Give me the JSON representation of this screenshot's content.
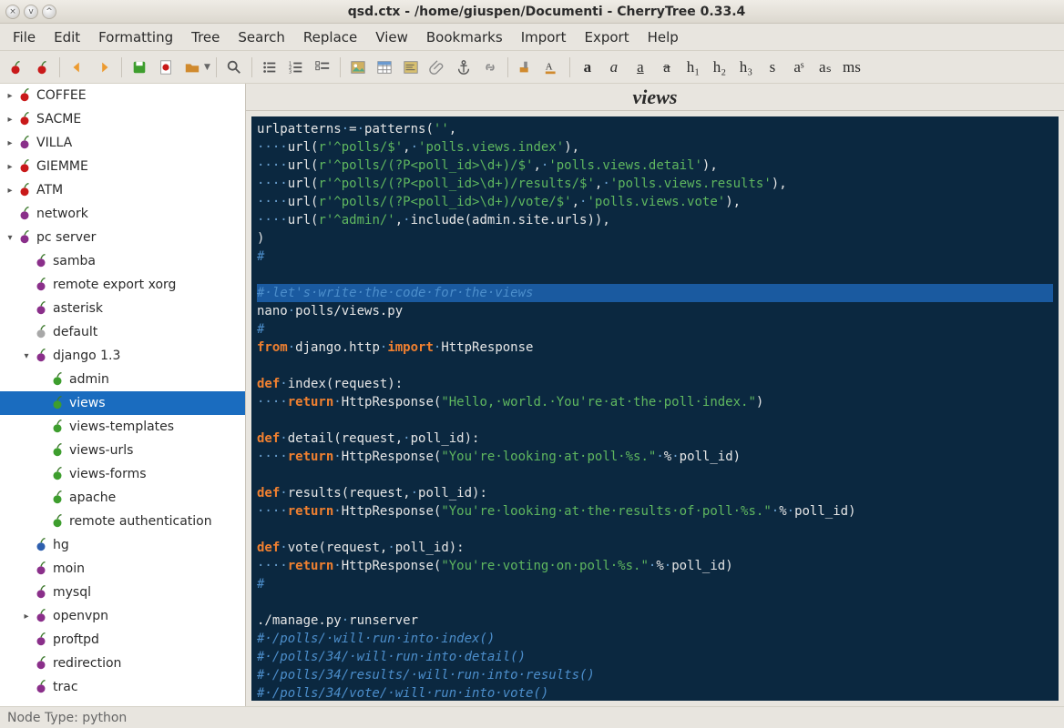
{
  "window": {
    "title": "qsd.ctx - /home/giuspen/Documenti - CherryTree 0.33.4"
  },
  "menu": [
    "File",
    "Edit",
    "Formatting",
    "Tree",
    "Search",
    "Replace",
    "View",
    "Bookmarks",
    "Import",
    "Export",
    "Help"
  ],
  "toolbar": {
    "icons": [
      {
        "name": "cherry-red-icon",
        "kind": "cherry",
        "color": "#c91a1a"
      },
      {
        "name": "cherry-red2-icon",
        "kind": "cherry",
        "color": "#c91a1a"
      },
      {
        "sep": true
      },
      {
        "name": "back-icon",
        "kind": "arrow-left",
        "color": "#ec9a2f"
      },
      {
        "name": "forward-icon",
        "kind": "arrow-right",
        "color": "#ec9a2f"
      },
      {
        "sep": true
      },
      {
        "name": "save-icon",
        "kind": "save",
        "color": "#3e9e2e"
      },
      {
        "name": "pdf-icon",
        "kind": "pdf",
        "color": "#c91a1a"
      },
      {
        "name": "folder-icon",
        "kind": "folder",
        "color": "#d08a2e"
      },
      {
        "name": "folder-drop-icon",
        "kind": "dropdown"
      },
      {
        "sep": true
      },
      {
        "name": "search-icon",
        "kind": "search",
        "color": "#555"
      },
      {
        "sep": true
      },
      {
        "name": "list-ul-icon",
        "kind": "list"
      },
      {
        "name": "list-ol-icon",
        "kind": "list2"
      },
      {
        "name": "list-task-icon",
        "kind": "listchk"
      },
      {
        "sep": true
      },
      {
        "name": "image-icon",
        "kind": "image"
      },
      {
        "name": "table-icon",
        "kind": "table"
      },
      {
        "name": "codebox-icon",
        "kind": "codebox"
      },
      {
        "name": "attach-icon",
        "kind": "attach"
      },
      {
        "name": "anchor-icon",
        "kind": "anchor"
      },
      {
        "name": "link-icon",
        "kind": "link"
      },
      {
        "sep": true
      },
      {
        "name": "paint-icon",
        "kind": "paint",
        "color": "#d08a2e"
      },
      {
        "name": "paint2-icon",
        "kind": "paint2",
        "color": "#d08a2e"
      },
      {
        "sep": true
      },
      {
        "name": "bold-icon",
        "kind": "text",
        "label": "a",
        "style": "font-weight:bold"
      },
      {
        "name": "italic-icon",
        "kind": "text",
        "label": "a",
        "style": "font-style:italic"
      },
      {
        "name": "underline-icon",
        "kind": "text",
        "label": "a",
        "style": "text-decoration:underline"
      },
      {
        "name": "strike-icon",
        "kind": "text",
        "label": "a",
        "style": "text-decoration:line-through"
      },
      {
        "name": "h1-icon",
        "kind": "text",
        "label": "h₁"
      },
      {
        "name": "h2-icon",
        "kind": "text",
        "label": "h₂"
      },
      {
        "name": "h3-icon",
        "kind": "text",
        "label": "h₃"
      },
      {
        "name": "small-icon",
        "kind": "text",
        "label": "s"
      },
      {
        "name": "sup-icon",
        "kind": "text",
        "label": "aˢ"
      },
      {
        "name": "sub-icon",
        "kind": "text",
        "label": "aₛ"
      },
      {
        "name": "mono-icon",
        "kind": "text",
        "label": "ms"
      }
    ]
  },
  "tree": [
    {
      "d": 0,
      "exp": "▸",
      "c": "red",
      "label": "COFFEE"
    },
    {
      "d": 0,
      "exp": "▸",
      "c": "red",
      "label": "SACME"
    },
    {
      "d": 0,
      "exp": "▸",
      "c": "purp",
      "label": "VILLA"
    },
    {
      "d": 0,
      "exp": "▸",
      "c": "red",
      "label": "GIEMME"
    },
    {
      "d": 0,
      "exp": "▸",
      "c": "red",
      "label": "ATM"
    },
    {
      "d": 0,
      "exp": "",
      "c": "purp",
      "label": "network"
    },
    {
      "d": 0,
      "exp": "▾",
      "c": "purp",
      "label": "pc server"
    },
    {
      "d": 1,
      "exp": "",
      "c": "purp",
      "label": "samba"
    },
    {
      "d": 1,
      "exp": "",
      "c": "purp",
      "label": "remote export xorg"
    },
    {
      "d": 1,
      "exp": "",
      "c": "purp",
      "label": "asterisk"
    },
    {
      "d": 1,
      "exp": "",
      "c": "gray",
      "label": "default"
    },
    {
      "d": 1,
      "exp": "▾",
      "c": "purp",
      "label": "django 1.3"
    },
    {
      "d": 2,
      "exp": "",
      "c": "green",
      "label": "admin"
    },
    {
      "d": 2,
      "exp": "",
      "c": "green",
      "label": "views",
      "selected": true
    },
    {
      "d": 2,
      "exp": "",
      "c": "green",
      "label": "views-templates"
    },
    {
      "d": 2,
      "exp": "",
      "c": "green",
      "label": "views-urls"
    },
    {
      "d": 2,
      "exp": "",
      "c": "green",
      "label": "views-forms"
    },
    {
      "d": 2,
      "exp": "",
      "c": "green",
      "label": "apache"
    },
    {
      "d": 2,
      "exp": "",
      "c": "green",
      "label": "remote authentication"
    },
    {
      "d": 1,
      "exp": "",
      "c": "blue",
      "label": "hg"
    },
    {
      "d": 1,
      "exp": "",
      "c": "purp",
      "label": "moin"
    },
    {
      "d": 1,
      "exp": "",
      "c": "purp",
      "label": "mysql"
    },
    {
      "d": 1,
      "exp": "▸",
      "c": "purp",
      "label": "openvpn"
    },
    {
      "d": 1,
      "exp": "",
      "c": "purp",
      "label": "proftpd"
    },
    {
      "d": 1,
      "exp": "",
      "c": "purp",
      "label": "redirection"
    },
    {
      "d": 1,
      "exp": "",
      "c": "purp",
      "label": "trac"
    }
  ],
  "content": {
    "title": "views"
  },
  "status": {
    "text": "Node Type: python"
  },
  "code": {
    "lines": [
      [
        [
          "fn",
          "urlpatterns"
        ],
        [
          "d",
          "·"
        ],
        [
          "op",
          "="
        ],
        [
          "d",
          "·"
        ],
        [
          "fn",
          "patterns("
        ],
        [
          "str",
          "''"
        ],
        [
          "fn",
          ","
        ]
      ],
      [
        [
          "d",
          "····"
        ],
        [
          "fn",
          "url("
        ],
        [
          "str",
          "r'^polls/$'"
        ],
        [
          "fn",
          ","
        ],
        [
          "d",
          "·"
        ],
        [
          "str",
          "'polls.views.index'"
        ],
        [
          "fn",
          "),"
        ]
      ],
      [
        [
          "d",
          "····"
        ],
        [
          "fn",
          "url("
        ],
        [
          "str",
          "r'^polls/(?P<poll_id>\\d+)/$'"
        ],
        [
          "fn",
          ","
        ],
        [
          "d",
          "·"
        ],
        [
          "str",
          "'polls.views.detail'"
        ],
        [
          "fn",
          "),"
        ]
      ],
      [
        [
          "d",
          "····"
        ],
        [
          "fn",
          "url("
        ],
        [
          "str",
          "r'^polls/(?P<poll_id>\\d+)/results/$'"
        ],
        [
          "fn",
          ","
        ],
        [
          "d",
          "·"
        ],
        [
          "str",
          "'polls.views.results'"
        ],
        [
          "fn",
          "),"
        ]
      ],
      [
        [
          "d",
          "····"
        ],
        [
          "fn",
          "url("
        ],
        [
          "str",
          "r'^polls/(?P<poll_id>\\d+)/vote/$'"
        ],
        [
          "fn",
          ","
        ],
        [
          "d",
          "·"
        ],
        [
          "str",
          "'polls.views.vote'"
        ],
        [
          "fn",
          "),"
        ]
      ],
      [
        [
          "d",
          "····"
        ],
        [
          "fn",
          "url("
        ],
        [
          "str",
          "r'^admin/'"
        ],
        [
          "fn",
          ","
        ],
        [
          "d",
          "·"
        ],
        [
          "fn",
          "include(admin.site.urls)),"
        ]
      ],
      [
        [
          "fn",
          ")"
        ]
      ],
      [
        [
          "cm",
          "#"
        ]
      ],
      [
        [
          "fn",
          ""
        ]
      ],
      {
        "hl": true,
        "spans": [
          [
            "cm",
            "#·let's·write·the·code·for·the·views"
          ]
        ]
      },
      [
        [
          "fn",
          "nano"
        ],
        [
          "d",
          "·"
        ],
        [
          "fn",
          "polls/views.py"
        ]
      ],
      [
        [
          "cm",
          "#"
        ]
      ],
      [
        [
          "kw",
          "from"
        ],
        [
          "d",
          "·"
        ],
        [
          "fn",
          "django.http"
        ],
        [
          "d",
          "·"
        ],
        [
          "kw",
          "import"
        ],
        [
          "d",
          "·"
        ],
        [
          "fn",
          "HttpResponse"
        ]
      ],
      [
        [
          "fn",
          ""
        ]
      ],
      [
        [
          "kw",
          "def"
        ],
        [
          "d",
          "·"
        ],
        [
          "fn",
          "index(request):"
        ]
      ],
      [
        [
          "d",
          "····"
        ],
        [
          "kw",
          "return"
        ],
        [
          "d",
          "·"
        ],
        [
          "fn",
          "HttpResponse("
        ],
        [
          "str",
          "\"Hello,·world.·You're·at·the·poll·index.\""
        ],
        [
          "fn",
          ")"
        ]
      ],
      [
        [
          "fn",
          ""
        ]
      ],
      [
        [
          "kw",
          "def"
        ],
        [
          "d",
          "·"
        ],
        [
          "fn",
          "detail(request,"
        ],
        [
          "d",
          "·"
        ],
        [
          "fn",
          "poll_id):"
        ]
      ],
      [
        [
          "d",
          "····"
        ],
        [
          "kw",
          "return"
        ],
        [
          "d",
          "·"
        ],
        [
          "fn",
          "HttpResponse("
        ],
        [
          "str",
          "\"You're·looking·at·poll·%s.\""
        ],
        [
          "d",
          "·"
        ],
        [
          "fn",
          "%"
        ],
        [
          "d",
          "·"
        ],
        [
          "fn",
          "poll_id)"
        ]
      ],
      [
        [
          "fn",
          ""
        ]
      ],
      [
        [
          "kw",
          "def"
        ],
        [
          "d",
          "·"
        ],
        [
          "fn",
          "results(request,"
        ],
        [
          "d",
          "·"
        ],
        [
          "fn",
          "poll_id):"
        ]
      ],
      [
        [
          "d",
          "····"
        ],
        [
          "kw",
          "return"
        ],
        [
          "d",
          "·"
        ],
        [
          "fn",
          "HttpResponse("
        ],
        [
          "str",
          "\"You're·looking·at·the·results·of·poll·%s.\""
        ],
        [
          "d",
          "·"
        ],
        [
          "fn",
          "%"
        ],
        [
          "d",
          "·"
        ],
        [
          "fn",
          "poll_id)"
        ]
      ],
      [
        [
          "fn",
          ""
        ]
      ],
      [
        [
          "kw",
          "def"
        ],
        [
          "d",
          "·"
        ],
        [
          "fn",
          "vote(request,"
        ],
        [
          "d",
          "·"
        ],
        [
          "fn",
          "poll_id):"
        ]
      ],
      [
        [
          "d",
          "····"
        ],
        [
          "kw",
          "return"
        ],
        [
          "d",
          "·"
        ],
        [
          "fn",
          "HttpResponse("
        ],
        [
          "str",
          "\"You're·voting·on·poll·%s.\""
        ],
        [
          "d",
          "·"
        ],
        [
          "fn",
          "%"
        ],
        [
          "d",
          "·"
        ],
        [
          "fn",
          "poll_id)"
        ]
      ],
      [
        [
          "cm",
          "#"
        ]
      ],
      [
        [
          "fn",
          ""
        ]
      ],
      [
        [
          "fn",
          "./manage.py"
        ],
        [
          "d",
          "·"
        ],
        [
          "fn",
          "runserver"
        ]
      ],
      [
        [
          "cm",
          "#·/polls/·will·run·into·index()"
        ]
      ],
      [
        [
          "cm",
          "#·/polls/34/·will·run·into·detail()"
        ]
      ],
      [
        [
          "cm",
          "#·/polls/34/results/·will·run·into·results()"
        ]
      ],
      [
        [
          "cm",
          "#·/polls/34/vote/·will·run·into·vote()"
        ]
      ]
    ]
  }
}
